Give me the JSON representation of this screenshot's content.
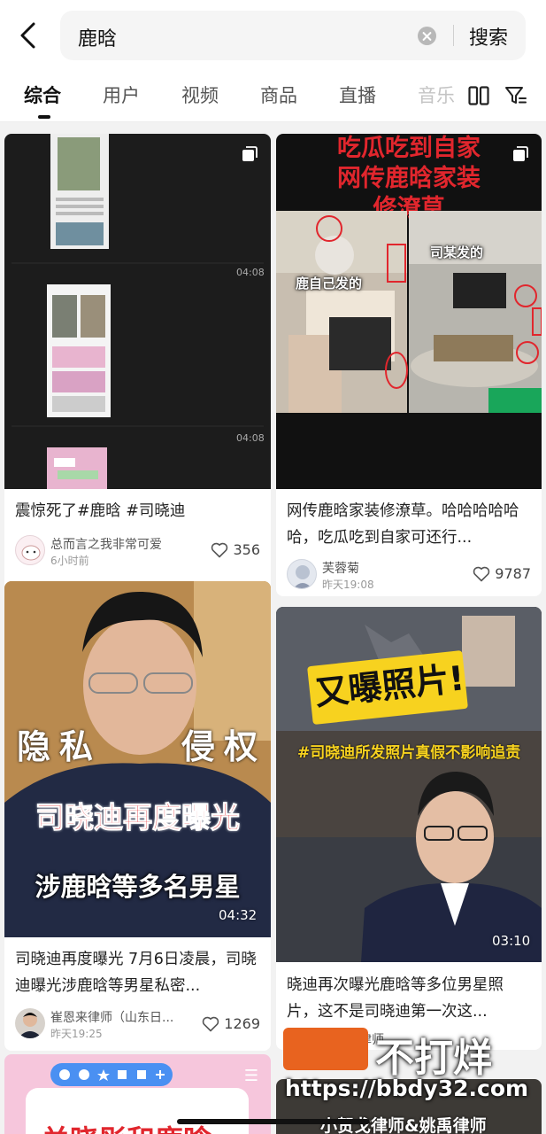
{
  "search": {
    "query": "鹿晗",
    "button_label": "搜索"
  },
  "tabs": [
    {
      "label": "综合"
    },
    {
      "label": "用户"
    },
    {
      "label": "视频"
    },
    {
      "label": "商品"
    },
    {
      "label": "直播"
    },
    {
      "label": "音乐"
    }
  ],
  "cards": [
    {
      "title": "震惊死了#鹿晗 #司晓迪",
      "author": "总而言之我非常可爱",
      "time": "6小时前",
      "likes": "356",
      "durations": [
        "04:08",
        "04:08"
      ]
    },
    {
      "title": "网传鹿晗家装修潦草。哈哈哈哈哈哈，吃瓜吃到自家可还行...",
      "author": "芙蓉菊",
      "time": "昨天19:08",
      "likes": "9787",
      "overlay_headline": [
        "吃瓜吃到自家",
        "网传鹿晗家装",
        "修潦草"
      ],
      "overlay_left": "鹿自己发的",
      "overlay_right": "司某发的"
    },
    {
      "title": "司晓迪再度曝光 7月6日凌晨，司晓迪曝光涉鹿晗等男星私密...",
      "author": "崔恩来律师（山东日...",
      "time": "昨天19:25",
      "likes": "1269",
      "duration": "04:32",
      "overlay_line1_left": "隐私",
      "overlay_line1_right": "侵权",
      "overlay_line2": "司晓迪再度曝光",
      "overlay_line3": "涉鹿晗等多名男星"
    },
    {
      "title": "晓迪再次曝光鹿晗等多位男星照片，这不是司晓迪第一次这...",
      "author": "小贺戈律师",
      "time": "",
      "likes": "",
      "duration": "03:10",
      "overlay_headline": "又曝照片!",
      "overlay_tag": "#司晓迪所发照片真假不影响追责"
    },
    {
      "overlay_text": "关晓彤和鹿晗"
    },
    {
      "overlay_text": "小贺戈律师&姚禹律师"
    }
  ],
  "watermark": {
    "brand": "不打烊",
    "url": "https://bbdy32.com"
  },
  "colors": {
    "accent_red": "#e1262d",
    "watermark_orange": "#e8631f",
    "headline_yellow": "#f7d21f"
  }
}
